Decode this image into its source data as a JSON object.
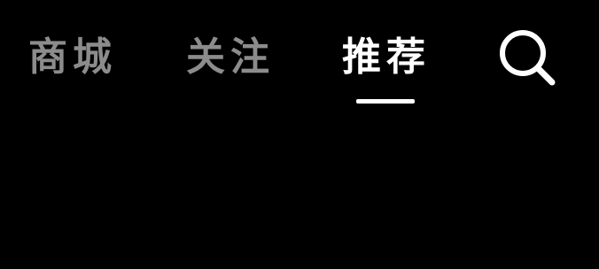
{
  "nav": {
    "tabs": [
      {
        "label": "商城",
        "state": "inactive"
      },
      {
        "label": "关注",
        "state": "inactive"
      },
      {
        "label": "推荐",
        "state": "active"
      }
    ],
    "search_icon": "search-icon"
  },
  "colors": {
    "background": "#000000",
    "active_text": "#ffffff",
    "inactive_text": "#8c8c8c",
    "underline": "#ffffff"
  }
}
